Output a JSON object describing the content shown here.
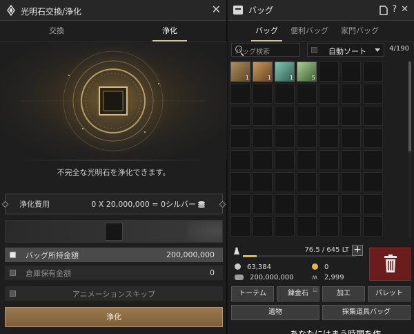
{
  "purify_window": {
    "title": "光明石交換/浄化",
    "tabs": [
      {
        "label": "交換",
        "active": false
      },
      {
        "label": "浄化",
        "active": true
      }
    ],
    "description": "不完全な光明石を浄化できます。",
    "cost": {
      "label": "浄化費用",
      "value": "0 X 20,000,000 = 0シルバー"
    },
    "options": [
      {
        "label": "バッグ所持金額",
        "value": "200,000,000",
        "checked": true
      },
      {
        "label": "倉庫保有金額",
        "value": "0",
        "checked": false
      },
      {
        "label": "アニメーションスキップ",
        "value": "",
        "checked": false
      }
    ],
    "action_label": "浄化",
    "accent_color": "#9b7a4f"
  },
  "bag_window": {
    "title": "バッグ",
    "title_icons": [
      "document-icon",
      "help-icon",
      "close-icon"
    ],
    "tabs": [
      {
        "label": "バッグ",
        "active": true
      },
      {
        "label": "便利バッグ",
        "active": false
      },
      {
        "label": "家門バッグ",
        "active": false
      }
    ],
    "search_placeholder": "バッグ検索",
    "sort_label": "自動ソート",
    "capacity": "4/190",
    "items": [
      {
        "name": "item-slot-1",
        "count": "1"
      },
      {
        "name": "item-slot-2",
        "count": "1"
      },
      {
        "name": "item-slot-3",
        "count": "1"
      },
      {
        "name": "item-slot-4",
        "count": "5"
      }
    ],
    "weight": "76.5 / 645 LT",
    "weight_fraction": 0.119,
    "silver": "63,384",
    "bank_silver": "200,000,000",
    "gold": "0",
    "mileage": "2,999",
    "buttons_row1": [
      "トーテム",
      "錬金石",
      "加工",
      "パレット"
    ],
    "buttons_row2": [
      "遺物",
      "採集道具バッグ"
    ]
  },
  "subtitle": "あなたにはまう時間を作"
}
